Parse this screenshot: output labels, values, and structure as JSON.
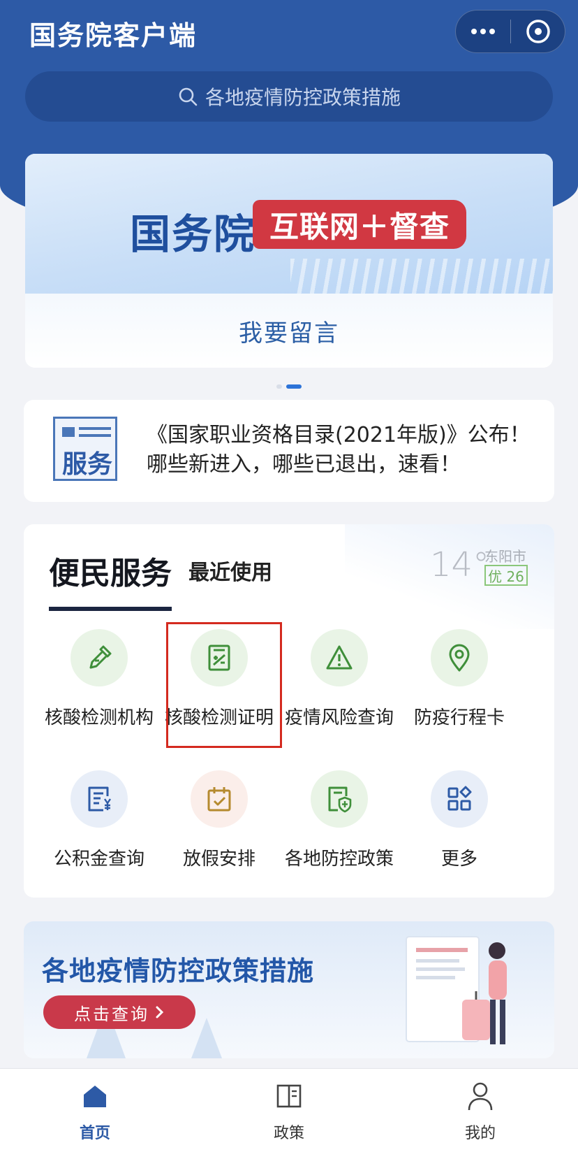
{
  "header": {
    "title": "国务院客户端",
    "menu_icon": "more-dots-icon",
    "close_icon": "close-circle-icon"
  },
  "search": {
    "placeholder": "各地疫情防控政策措施",
    "icon": "search-icon"
  },
  "banner": {
    "brand": "国务院",
    "tag": "互联网＋督查",
    "link": "我要留言",
    "carousel_active_index": 1,
    "carousel_count": 2
  },
  "news": {
    "badge": "服务",
    "text": "《国家职业资格目录(2021年版)》公布！哪些新进入，哪些已退出，速看！"
  },
  "services": {
    "tab_main": "便民服务",
    "tab_recent": "最近使用",
    "weather": {
      "temp": "14°",
      "city": "东阳市",
      "aqi": "优 26"
    },
    "items": [
      {
        "label": "核酸检测机构",
        "icon": "dropper-icon"
      },
      {
        "label": "核酸检测证明",
        "icon": "certificate-icon"
      },
      {
        "label": "疫情风险查询",
        "icon": "warning-icon"
      },
      {
        "label": "防疫行程卡",
        "icon": "location-pin-icon"
      },
      {
        "label": "公积金查询",
        "icon": "fund-document-icon"
      },
      {
        "label": "放假安排",
        "icon": "calendar-check-icon"
      },
      {
        "label": "各地防控政策",
        "icon": "shield-document-icon"
      },
      {
        "label": "更多",
        "icon": "grid-more-icon"
      }
    ]
  },
  "promo": {
    "title": "各地疫情防控政策措施",
    "button": "点击查询"
  },
  "tabbar": {
    "items": [
      {
        "label": "首页",
        "icon": "home-icon",
        "active": true
      },
      {
        "label": "政策",
        "icon": "book-icon",
        "active": false
      },
      {
        "label": "我的",
        "icon": "user-icon",
        "active": false
      }
    ]
  },
  "colors": {
    "brand_blue": "#2d5aa6",
    "accent_red": "#d13842",
    "icon_green": "#3f8f3a",
    "highlight_red": "#d42a1f"
  }
}
